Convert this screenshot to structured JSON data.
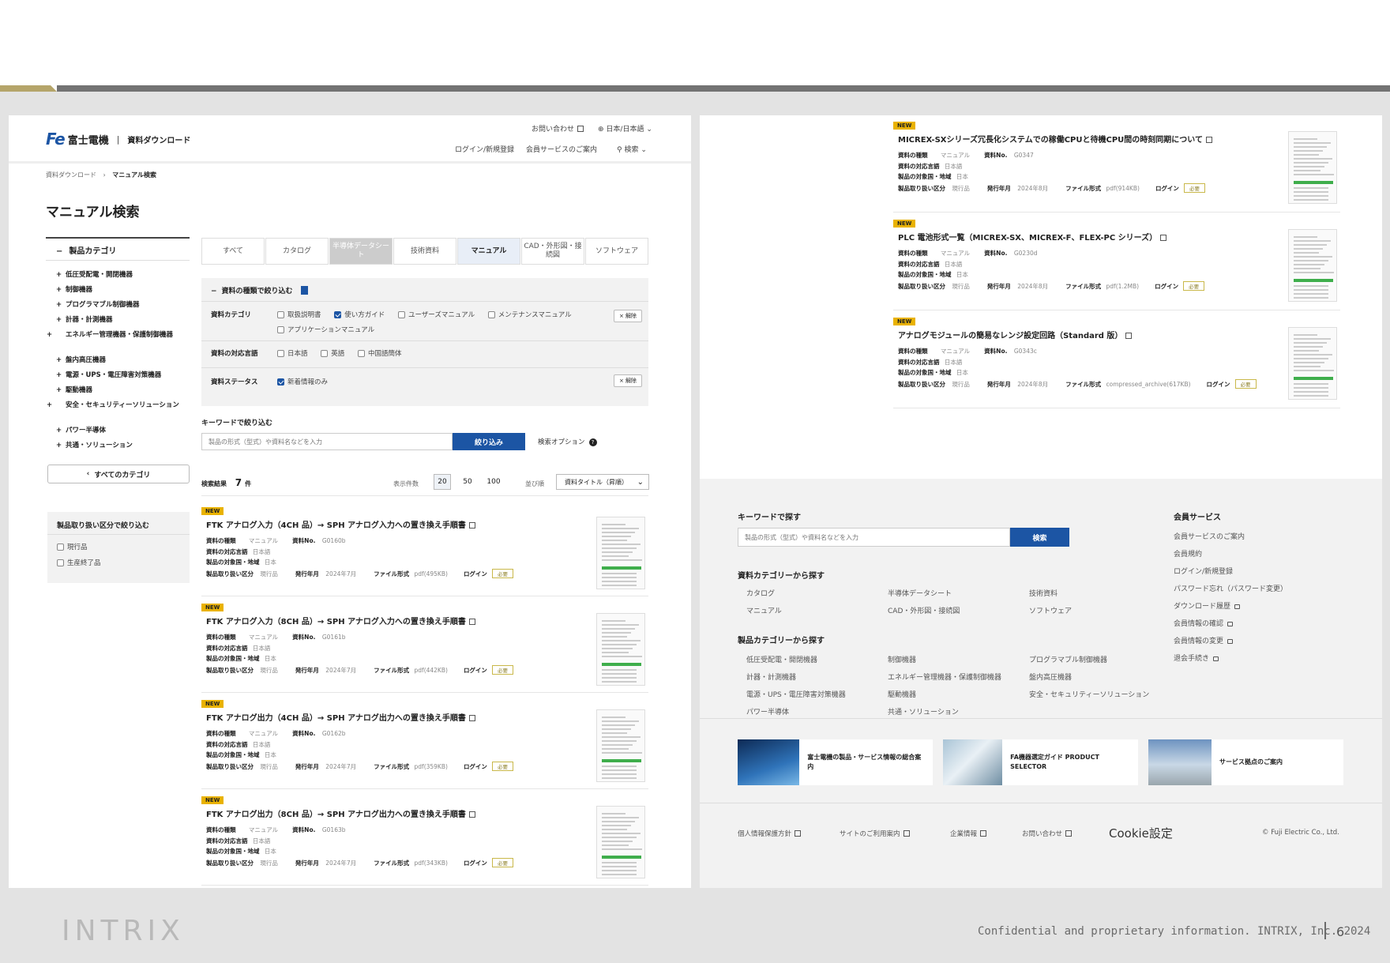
{
  "slide": {
    "brand": "INTRIX",
    "footer_text": "Confidential and proprietary information. INTRIX, Inc. 2024",
    "page_number": "6"
  },
  "header": {
    "logo_mark": "Fe",
    "company": "富士電機",
    "divider": "|",
    "site_title": "資料ダウンロード",
    "contact": "お問い合わせ",
    "language": "日本/日本語",
    "login": "ログイン/新規登録",
    "member_service": "会員サービスのご案内",
    "search": "検索"
  },
  "breadcrumb": {
    "home": "資料ダウンロード",
    "sep": "›",
    "current": "マニュアル検索"
  },
  "page_title": "マニュアル検索",
  "sidebar": {
    "category_title": "製品カテゴリ",
    "categories": [
      "低圧受配電・開閉機器",
      "制御機器",
      "プログラマブル制御機器",
      "計器・計測機器",
      "エネルギー管理機器・保護制御機器",
      "盤内高圧機器",
      "電源・UPS・電圧障害対策機器",
      "駆動機器",
      "安全・セキュリティーソリューション",
      "パワー半導体",
      "共通・ソリューション"
    ],
    "all_categories": "すべてのカテゴリ",
    "handling_title": "製品取り扱い区分で絞り込む",
    "handling_options": [
      "現行品",
      "生産終了品"
    ]
  },
  "tabs": [
    "すべて",
    "カタログ",
    "半導体データシート",
    "技術資料",
    "マニュアル",
    "CAD・外形図・接続図",
    "ソフトウェア"
  ],
  "filters": {
    "title": "資料の種類で絞り込む",
    "category_label": "資料カテゴリ",
    "category_options": [
      "取扱説明書",
      "使い方ガイド",
      "ユーザーズマニュアル",
      "メンテナンスマニュアル",
      "アプリケーションマニュアル"
    ],
    "clear": "× 解除",
    "language_label": "資料の対応言語",
    "language_options": [
      "日本語",
      "英語",
      "中国語簡体"
    ],
    "status_label": "資料ステータス",
    "status_option": "新着情報のみ",
    "clear2": "× 解除"
  },
  "keyword": {
    "label": "キーワードで絞り込む",
    "placeholder": "製品の形式（型式）や資料名などを入力",
    "button": "絞り込み",
    "options": "検索オプション"
  },
  "results": {
    "count_label": "検索結果",
    "count": "7",
    "count_unit": "件",
    "per_page_label": "表示件数",
    "per_page": [
      "20",
      "50",
      "100"
    ],
    "sort_label": "並び順",
    "sort_value": "資料タイトル（昇順）"
  },
  "meta_labels": {
    "type": "資料の種類",
    "no": "資料No.",
    "lang": "資料の対応言語",
    "target": "製品の対象国・地域",
    "handling": "製品取り扱い区分",
    "issued": "発行年月",
    "format": "ファイル形式",
    "login": "ログイン",
    "required": "必要"
  },
  "items_left": [
    {
      "badge": "NEW",
      "title": "FTK アナログ入力（4CH 品）→ SPH アナログ入力への置き換え手順書",
      "type": "マニュアル",
      "no": "G0160b",
      "lang": "日本語",
      "target": "日本",
      "handling": "現行品",
      "issued": "2024年7月",
      "format": "pdf(495KB)"
    },
    {
      "badge": "NEW",
      "title": "FTK アナログ入力（8CH 品）→ SPH アナログ入力への置き換え手順書",
      "type": "マニュアル",
      "no": "G0161b",
      "lang": "日本語",
      "target": "日本",
      "handling": "現行品",
      "issued": "2024年7月",
      "format": "pdf(442KB)"
    },
    {
      "badge": "NEW",
      "title": "FTK アナログ出力（4CH 品）→ SPH アナログ出力への置き換え手順書",
      "type": "マニュアル",
      "no": "G0162b",
      "lang": "日本語",
      "target": "日本",
      "handling": "現行品",
      "issued": "2024年7月",
      "format": "pdf(359KB)"
    },
    {
      "badge": "NEW",
      "title": "FTK アナログ出力（8CH 品）→ SPH アナログ出力への置き換え手順書",
      "type": "マニュアル",
      "no": "G0163b",
      "lang": "日本語",
      "target": "日本",
      "handling": "現行品",
      "issued": "2024年7月",
      "format": "pdf(343KB)"
    }
  ],
  "items_right": [
    {
      "badge": "NEW",
      "title": "MICREX-SXシリーズ冗長化システムでの稼働CPUと待機CPU間の時刻同期について",
      "type": "マニュアル",
      "no": "G0347",
      "lang": "日本語",
      "target": "日本",
      "handling": "現行品",
      "issued": "2024年8月",
      "format": "pdf(914KB)"
    },
    {
      "badge": "NEW",
      "title": "PLC 電池形式一覧（MICREX-SX、MICREX-F、FLEX-PC シリーズ）",
      "type": "マニュアル",
      "no": "G0230d",
      "lang": "日本語",
      "target": "日本",
      "handling": "現行品",
      "issued": "2024年8月",
      "format": "pdf(1.2MB)"
    },
    {
      "badge": "NEW",
      "title": "アナログモジュールの簡易なレンジ設定回路（Standard 版）",
      "type": "マニュアル",
      "no": "G0343c",
      "lang": "日本語",
      "target": "日本",
      "handling": "現行品",
      "issued": "2024年8月",
      "format": "compressed_archive(617KB)"
    }
  ],
  "footer": {
    "keyword_title": "キーワードで探す",
    "keyword_placeholder": "製品の形式（型式）や資料名などを入力",
    "search_button": "検索",
    "doc_cat_title": "資料カテゴリーから探す",
    "doc_cats": [
      "カタログ",
      "半導体データシート",
      "技術資料",
      "マニュアル",
      "CAD・外形図・接続図",
      "ソフトウェア"
    ],
    "prod_cat_title": "製品カテゴリーから探す",
    "prod_cats": [
      "低圧受配電・開閉機器",
      "制御機器",
      "プログラマブル制御機器",
      "計器・計測機器",
      "エネルギー管理機器・保護制御機器",
      "盤内高圧機器",
      "電源・UPS・電圧障害対策機器",
      "駆動機器",
      "安全・セキュリティーソリューション",
      "パワー半導体",
      "共通・ソリューション"
    ],
    "member_title": "会員サービス",
    "member_links": [
      "会員サービスのご案内",
      "会員規約",
      "ログイン/新規登録",
      "パスワード忘れ（パスワード変更）",
      "ダウンロード履歴",
      "会員情報の確認",
      "会員情報の変更",
      "退会手続き"
    ],
    "banners": [
      "富士電機の製品・サービス情報の総合案内",
      "FA機器選定ガイド PRODUCT SELECTOR",
      "サービス拠点のご案内"
    ],
    "bottom_links": [
      "個人情報保護方針",
      "サイトのご利用案内",
      "企業情報",
      "お問い合わせ"
    ],
    "cookie": "Cookie設定",
    "copyright": "© Fuji Electric Co., Ltd."
  }
}
